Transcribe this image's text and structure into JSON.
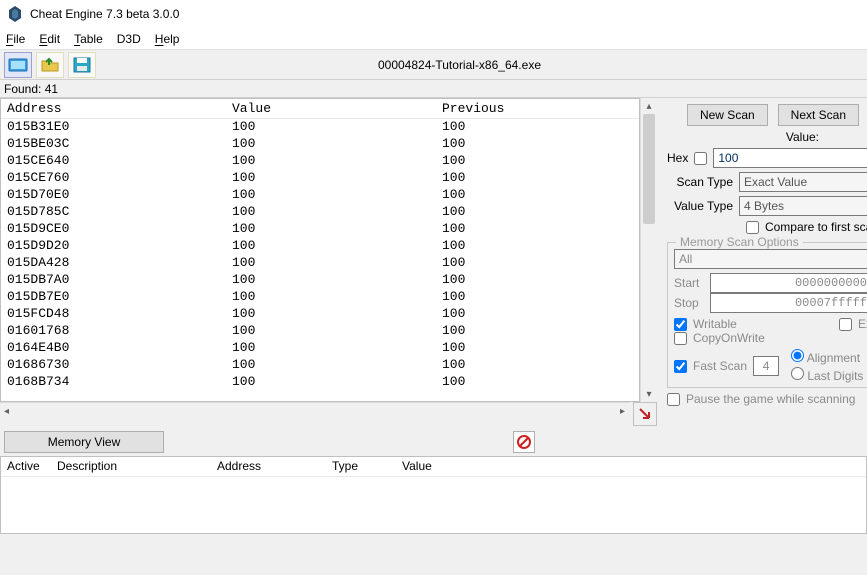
{
  "title": "Cheat Engine 7.3 beta 3.0.0",
  "menubar": {
    "file": "File",
    "edit": "Edit",
    "table": "Table",
    "d3d": "D3D",
    "help": "Help"
  },
  "process": "00004824-Tutorial-x86_64.exe",
  "found_label": "Found: 41",
  "columns": {
    "address": "Address",
    "value": "Value",
    "previous": "Previous"
  },
  "results": [
    {
      "address": "015B31E0",
      "value": "100",
      "previous": "100"
    },
    {
      "address": "015BE03C",
      "value": "100",
      "previous": "100"
    },
    {
      "address": "015CE640",
      "value": "100",
      "previous": "100"
    },
    {
      "address": "015CE760",
      "value": "100",
      "previous": "100"
    },
    {
      "address": "015D70E0",
      "value": "100",
      "previous": "100"
    },
    {
      "address": "015D785C",
      "value": "100",
      "previous": "100"
    },
    {
      "address": "015D9CE0",
      "value": "100",
      "previous": "100"
    },
    {
      "address": "015D9D20",
      "value": "100",
      "previous": "100"
    },
    {
      "address": "015DA428",
      "value": "100",
      "previous": "100"
    },
    {
      "address": "015DB7A0",
      "value": "100",
      "previous": "100"
    },
    {
      "address": "015DB7E0",
      "value": "100",
      "previous": "100"
    },
    {
      "address": "015FCD48",
      "value": "100",
      "previous": "100"
    },
    {
      "address": "01601768",
      "value": "100",
      "previous": "100"
    },
    {
      "address": "0164E4B0",
      "value": "100",
      "previous": "100"
    },
    {
      "address": "01686730",
      "value": "100",
      "previous": "100"
    },
    {
      "address": "0168B734",
      "value": "100",
      "previous": "100"
    }
  ],
  "right": {
    "new_scan": "New Scan",
    "next_scan": "Next Scan",
    "value_label": "Value:",
    "hex_label": "Hex",
    "value_input": "100",
    "scan_type_label": "Scan Type",
    "scan_type_value": "Exact Value",
    "value_type_label": "Value Type",
    "value_type_value": "4 Bytes",
    "compare_label": "Compare to first scan",
    "mem_legend": "Memory Scan Options",
    "mem_all": "All",
    "start_label": "Start",
    "start_value": "0000000000",
    "stop_label": "Stop",
    "stop_value": "00007fffff",
    "writable": "Writable",
    "executable": "Ex",
    "copyonwrite": "CopyOnWrite",
    "fast_scan": "Fast Scan",
    "fast_value": "4",
    "alignment": "Alignment",
    "last_digits": "Last Digits",
    "pause_label": "Pause the game while scanning"
  },
  "memview": "Memory View",
  "addr_table": {
    "active": "Active",
    "description": "Description",
    "address": "Address",
    "type": "Type",
    "value": "Value"
  }
}
